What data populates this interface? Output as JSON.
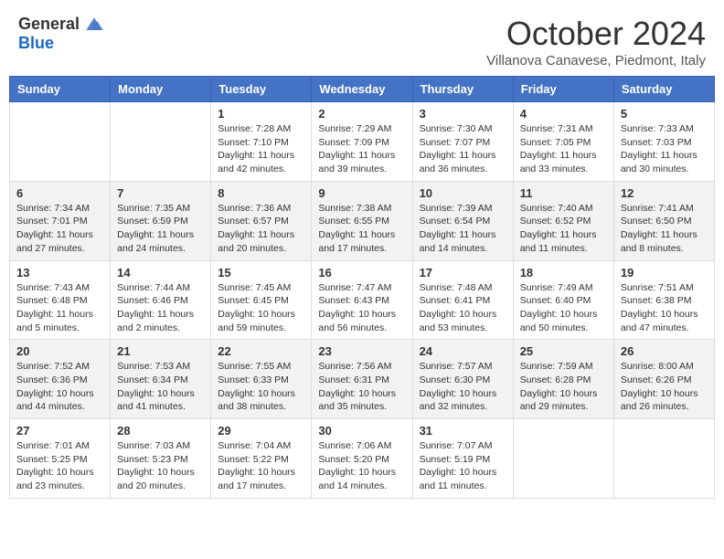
{
  "header": {
    "logo_general": "General",
    "logo_blue": "Blue",
    "month_title": "October 2024",
    "location": "Villanova Canavese, Piedmont, Italy"
  },
  "days_of_week": [
    "Sunday",
    "Monday",
    "Tuesday",
    "Wednesday",
    "Thursday",
    "Friday",
    "Saturday"
  ],
  "weeks": [
    [
      {
        "day": "",
        "sunrise": "",
        "sunset": "",
        "daylight": ""
      },
      {
        "day": "",
        "sunrise": "",
        "sunset": "",
        "daylight": ""
      },
      {
        "day": "1",
        "sunrise": "Sunrise: 7:28 AM",
        "sunset": "Sunset: 7:10 PM",
        "daylight": "Daylight: 11 hours and 42 minutes."
      },
      {
        "day": "2",
        "sunrise": "Sunrise: 7:29 AM",
        "sunset": "Sunset: 7:09 PM",
        "daylight": "Daylight: 11 hours and 39 minutes."
      },
      {
        "day": "3",
        "sunrise": "Sunrise: 7:30 AM",
        "sunset": "Sunset: 7:07 PM",
        "daylight": "Daylight: 11 hours and 36 minutes."
      },
      {
        "day": "4",
        "sunrise": "Sunrise: 7:31 AM",
        "sunset": "Sunset: 7:05 PM",
        "daylight": "Daylight: 11 hours and 33 minutes."
      },
      {
        "day": "5",
        "sunrise": "Sunrise: 7:33 AM",
        "sunset": "Sunset: 7:03 PM",
        "daylight": "Daylight: 11 hours and 30 minutes."
      }
    ],
    [
      {
        "day": "6",
        "sunrise": "Sunrise: 7:34 AM",
        "sunset": "Sunset: 7:01 PM",
        "daylight": "Daylight: 11 hours and 27 minutes."
      },
      {
        "day": "7",
        "sunrise": "Sunrise: 7:35 AM",
        "sunset": "Sunset: 6:59 PM",
        "daylight": "Daylight: 11 hours and 24 minutes."
      },
      {
        "day": "8",
        "sunrise": "Sunrise: 7:36 AM",
        "sunset": "Sunset: 6:57 PM",
        "daylight": "Daylight: 11 hours and 20 minutes."
      },
      {
        "day": "9",
        "sunrise": "Sunrise: 7:38 AM",
        "sunset": "Sunset: 6:55 PM",
        "daylight": "Daylight: 11 hours and 17 minutes."
      },
      {
        "day": "10",
        "sunrise": "Sunrise: 7:39 AM",
        "sunset": "Sunset: 6:54 PM",
        "daylight": "Daylight: 11 hours and 14 minutes."
      },
      {
        "day": "11",
        "sunrise": "Sunrise: 7:40 AM",
        "sunset": "Sunset: 6:52 PM",
        "daylight": "Daylight: 11 hours and 11 minutes."
      },
      {
        "day": "12",
        "sunrise": "Sunrise: 7:41 AM",
        "sunset": "Sunset: 6:50 PM",
        "daylight": "Daylight: 11 hours and 8 minutes."
      }
    ],
    [
      {
        "day": "13",
        "sunrise": "Sunrise: 7:43 AM",
        "sunset": "Sunset: 6:48 PM",
        "daylight": "Daylight: 11 hours and 5 minutes."
      },
      {
        "day": "14",
        "sunrise": "Sunrise: 7:44 AM",
        "sunset": "Sunset: 6:46 PM",
        "daylight": "Daylight: 11 hours and 2 minutes."
      },
      {
        "day": "15",
        "sunrise": "Sunrise: 7:45 AM",
        "sunset": "Sunset: 6:45 PM",
        "daylight": "Daylight: 10 hours and 59 minutes."
      },
      {
        "day": "16",
        "sunrise": "Sunrise: 7:47 AM",
        "sunset": "Sunset: 6:43 PM",
        "daylight": "Daylight: 10 hours and 56 minutes."
      },
      {
        "day": "17",
        "sunrise": "Sunrise: 7:48 AM",
        "sunset": "Sunset: 6:41 PM",
        "daylight": "Daylight: 10 hours and 53 minutes."
      },
      {
        "day": "18",
        "sunrise": "Sunrise: 7:49 AM",
        "sunset": "Sunset: 6:40 PM",
        "daylight": "Daylight: 10 hours and 50 minutes."
      },
      {
        "day": "19",
        "sunrise": "Sunrise: 7:51 AM",
        "sunset": "Sunset: 6:38 PM",
        "daylight": "Daylight: 10 hours and 47 minutes."
      }
    ],
    [
      {
        "day": "20",
        "sunrise": "Sunrise: 7:52 AM",
        "sunset": "Sunset: 6:36 PM",
        "daylight": "Daylight: 10 hours and 44 minutes."
      },
      {
        "day": "21",
        "sunrise": "Sunrise: 7:53 AM",
        "sunset": "Sunset: 6:34 PM",
        "daylight": "Daylight: 10 hours and 41 minutes."
      },
      {
        "day": "22",
        "sunrise": "Sunrise: 7:55 AM",
        "sunset": "Sunset: 6:33 PM",
        "daylight": "Daylight: 10 hours and 38 minutes."
      },
      {
        "day": "23",
        "sunrise": "Sunrise: 7:56 AM",
        "sunset": "Sunset: 6:31 PM",
        "daylight": "Daylight: 10 hours and 35 minutes."
      },
      {
        "day": "24",
        "sunrise": "Sunrise: 7:57 AM",
        "sunset": "Sunset: 6:30 PM",
        "daylight": "Daylight: 10 hours and 32 minutes."
      },
      {
        "day": "25",
        "sunrise": "Sunrise: 7:59 AM",
        "sunset": "Sunset: 6:28 PM",
        "daylight": "Daylight: 10 hours and 29 minutes."
      },
      {
        "day": "26",
        "sunrise": "Sunrise: 8:00 AM",
        "sunset": "Sunset: 6:26 PM",
        "daylight": "Daylight: 10 hours and 26 minutes."
      }
    ],
    [
      {
        "day": "27",
        "sunrise": "Sunrise: 7:01 AM",
        "sunset": "Sunset: 5:25 PM",
        "daylight": "Daylight: 10 hours and 23 minutes."
      },
      {
        "day": "28",
        "sunrise": "Sunrise: 7:03 AM",
        "sunset": "Sunset: 5:23 PM",
        "daylight": "Daylight: 10 hours and 20 minutes."
      },
      {
        "day": "29",
        "sunrise": "Sunrise: 7:04 AM",
        "sunset": "Sunset: 5:22 PM",
        "daylight": "Daylight: 10 hours and 17 minutes."
      },
      {
        "day": "30",
        "sunrise": "Sunrise: 7:06 AM",
        "sunset": "Sunset: 5:20 PM",
        "daylight": "Daylight: 10 hours and 14 minutes."
      },
      {
        "day": "31",
        "sunrise": "Sunrise: 7:07 AM",
        "sunset": "Sunset: 5:19 PM",
        "daylight": "Daylight: 10 hours and 11 minutes."
      },
      {
        "day": "",
        "sunrise": "",
        "sunset": "",
        "daylight": ""
      },
      {
        "day": "",
        "sunrise": "",
        "sunset": "",
        "daylight": ""
      }
    ]
  ]
}
